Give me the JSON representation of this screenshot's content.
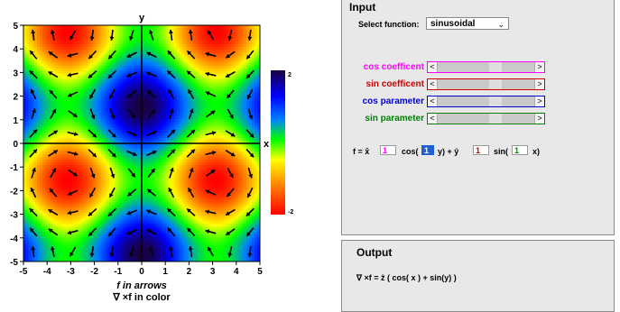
{
  "plot": {
    "y_axis_label": "y",
    "x_axis_label": "x",
    "x_ticks": [
      "-5",
      "-4",
      "-3",
      "-2",
      "-1",
      "0",
      "1",
      "2",
      "3",
      "4",
      "5"
    ],
    "y_ticks": [
      "5",
      "4",
      "3",
      "2",
      "1",
      "0",
      "-1",
      "-2",
      "-3",
      "-4",
      "-5"
    ],
    "caption_line1": "f in arrows",
    "caption_line2": "∇ ×f in color",
    "colorbar_max": "2",
    "colorbar_min": "-2",
    "colormap": [
      "#ff0000",
      "#ff8000",
      "#ffff00",
      "#00ff00",
      "#0080ff",
      "#0000ff",
      "#1a0040"
    ]
  },
  "input_panel": {
    "title": "Input",
    "select_label": "Select function:",
    "select_value": "sinusoidal",
    "sliders": [
      {
        "label": "cos coefficent",
        "color": "#ff00ff"
      },
      {
        "label": "sin coefficent",
        "color": "#cc0000"
      },
      {
        "label": "cos parameter",
        "color": "#0000cc"
      },
      {
        "label": "sin parameter",
        "color": "#008000"
      }
    ],
    "formula": {
      "f_eq": "f = x̂",
      "cos_coef": "1",
      "cos_text": "cos(",
      "cos_param": "1",
      "y_part": "y) + ŷ",
      "sin_coef": "1",
      "sin_text": "sin(",
      "sin_param": "1",
      "x_part": "x)"
    }
  },
  "output_panel": {
    "title": "Output",
    "result": "∇ ×f = ẑ ( cos( x ) + sin(y) )"
  }
}
